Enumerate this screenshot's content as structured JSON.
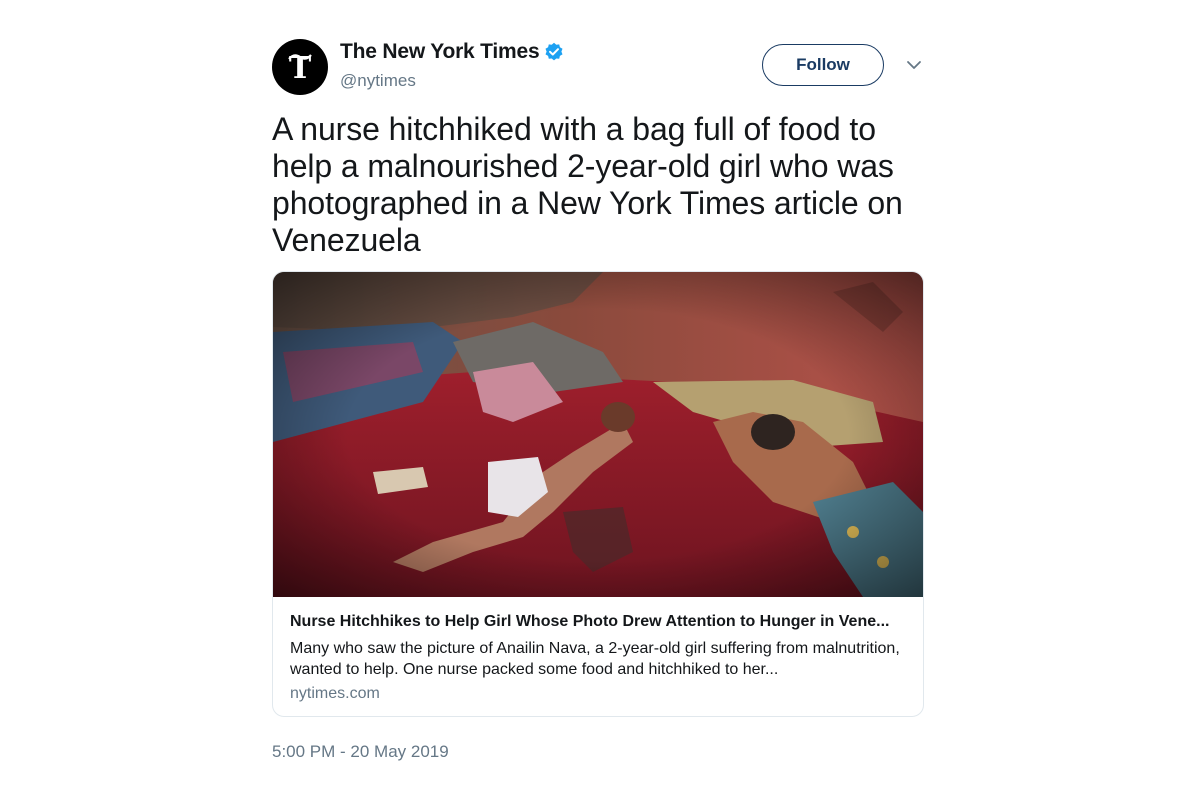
{
  "tweet": {
    "author": {
      "display_name": "The New York Times",
      "handle": "@nytimes",
      "avatar_icon": "nyt-logo-icon",
      "verified_icon": "verified-badge-icon",
      "verified_color": "#1da1f2"
    },
    "follow_label": "Follow",
    "menu_icon": "chevron-down-icon",
    "text": "A nurse hitchhiked with a bag full of food to help a malnourished 2-year-old girl who was photographed in a New York Times article on Venezuela",
    "card": {
      "image_icon": "article-photo",
      "title": "Nurse Hitchhikes to Help Girl Whose Photo Drew Attention to Hunger in Vene...",
      "description": "Many who saw the picture of Anailin Nava, a 2-year-old girl suffering from malnutrition, wanted to help. One nurse packed some food and hitchhiked to her...",
      "domain": "nytimes.com"
    },
    "timestamp": "5:00 PM - 20 May 2019"
  },
  "colors": {
    "text_primary": "#14171a",
    "text_secondary": "#657786",
    "follow_border": "#1a3b63",
    "card_border": "#e1e8ed"
  }
}
